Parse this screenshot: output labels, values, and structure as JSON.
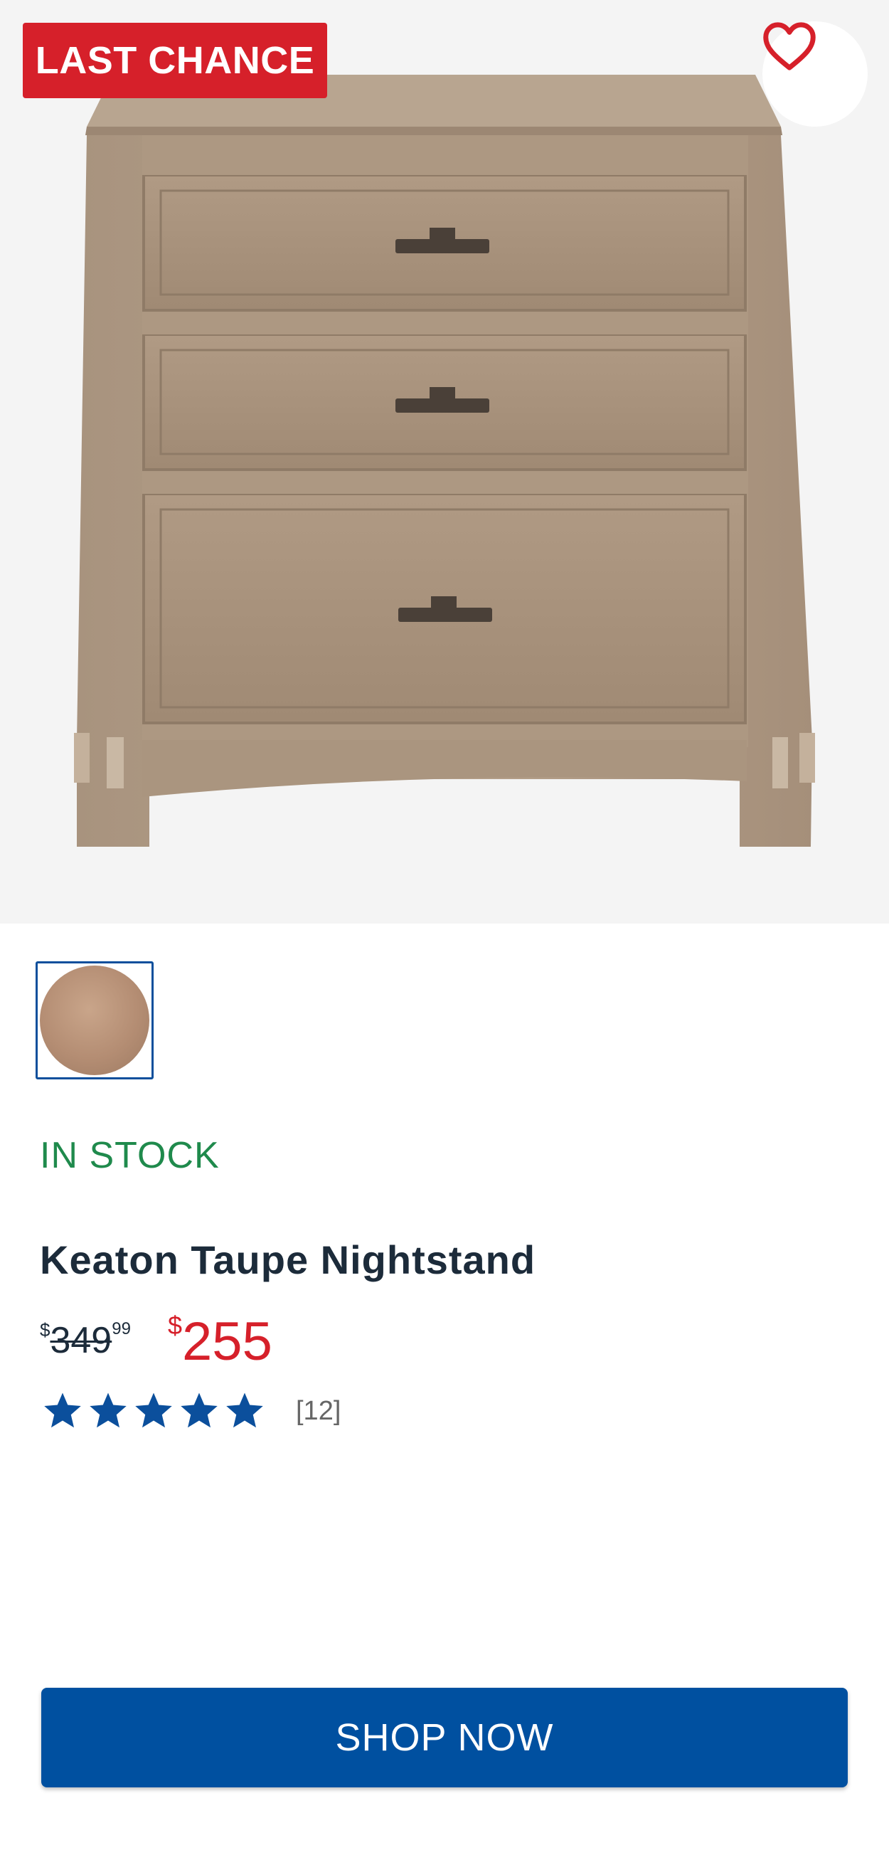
{
  "product": {
    "badge": "LAST CHANCE",
    "stock_status": "IN STOCK",
    "name": "Keaton Taupe Nightstand",
    "old_price": {
      "currency": "$",
      "dollars": "349",
      "cents": "99"
    },
    "new_price": {
      "currency": "$",
      "amount": "255"
    },
    "rating": {
      "stars": 5,
      "max_stars": 5,
      "review_count": "[12]"
    },
    "swatch_color": "#b48d73"
  },
  "actions": {
    "shop_now_label": "SHOP NOW"
  },
  "colors": {
    "badge_red": "#d6202a",
    "stock_green": "#1f8a4c",
    "brand_blue": "#0050a0",
    "star_blue": "#0b4f9c",
    "heart_red": "#d6202a"
  },
  "icons": {
    "favorite": "heart-icon",
    "rating": "star-icon"
  }
}
